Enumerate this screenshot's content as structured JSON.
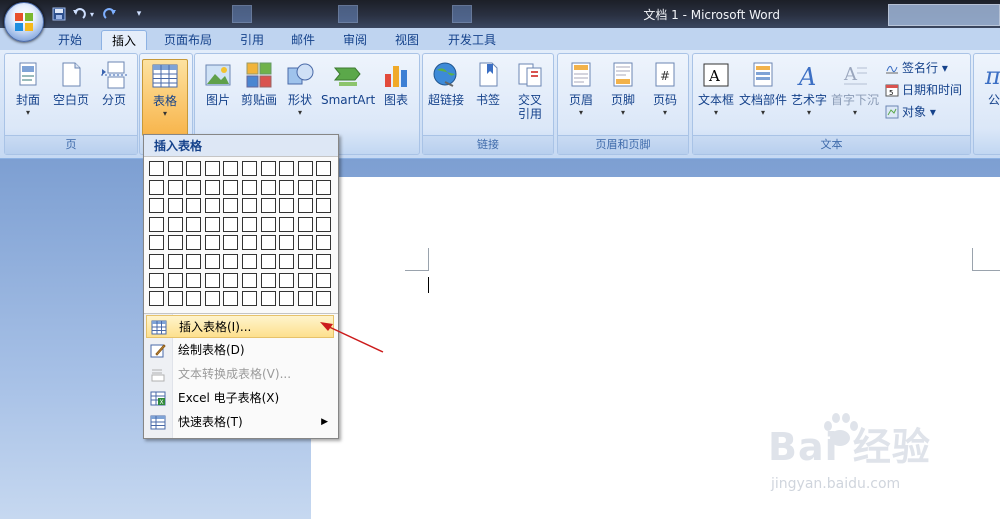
{
  "window": {
    "title": "文档 1 - Microsoft Word"
  },
  "tabs": [
    {
      "label": "开始"
    },
    {
      "label": "插入"
    },
    {
      "label": "页面布局"
    },
    {
      "label": "引用"
    },
    {
      "label": "邮件"
    },
    {
      "label": "审阅"
    },
    {
      "label": "视图"
    },
    {
      "label": "开发工具"
    }
  ],
  "active_tab": "插入",
  "ribbon": {
    "pages_group": {
      "label": "页",
      "buttons": [
        "封面",
        "空白页",
        "分页"
      ]
    },
    "tables_group": {
      "button": "表格"
    },
    "illustrations_group": {
      "buttons": [
        "图片",
        "剪贴画",
        "形状",
        "SmartArt",
        "图表"
      ]
    },
    "links_group": {
      "label": "链接",
      "buttons": [
        "超链接",
        "书签",
        "交叉",
        "引用"
      ]
    },
    "header_footer_group": {
      "label": "页眉和页脚",
      "buttons": [
        "页眉",
        "页脚",
        "页码"
      ]
    },
    "text_group": {
      "label": "文本",
      "buttons": [
        "文本框",
        "文档部件",
        "艺术字",
        "首字下沉"
      ],
      "small_buttons": [
        "签名行",
        "日期和时间",
        "对象"
      ]
    },
    "symbols_group": {
      "buttons": [
        "公"
      ]
    }
  },
  "menu": {
    "header": "插入表格",
    "grid": {
      "rows": 8,
      "cols": 10
    },
    "items": [
      {
        "label": "插入表格(I)...",
        "highlighted": true,
        "enabled": true
      },
      {
        "label": "绘制表格(D)",
        "enabled": true
      },
      {
        "label": "文本转换成表格(V)...",
        "enabled": false
      },
      {
        "label": "Excel 电子表格(X)",
        "enabled": true
      },
      {
        "label": "快速表格(T)",
        "enabled": true,
        "submenu": true
      }
    ]
  },
  "watermark": {
    "text": "Bai 经验",
    "url": "jingyan.baidu.com"
  },
  "colors": {
    "accent": "#15428b",
    "ribbon_bg": "#dbe7f8",
    "highlight": "#fde08d",
    "arrow": "#cc1b1b"
  }
}
